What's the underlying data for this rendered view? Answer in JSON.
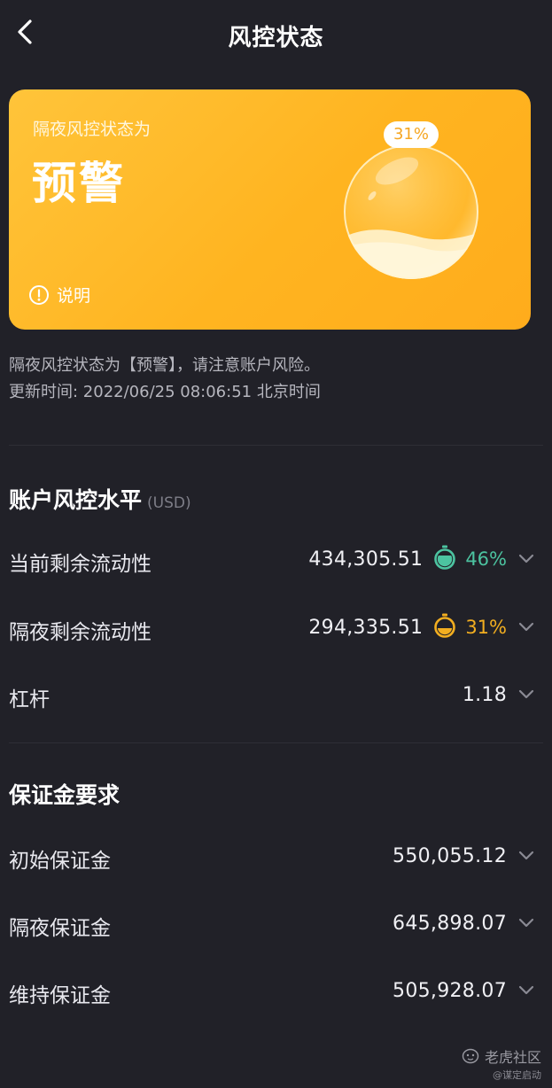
{
  "header": {
    "title": "风控状态",
    "back_icon": "chevron-left-icon"
  },
  "status_card": {
    "subtitle": "隔夜风控状态为",
    "status": "预警",
    "explain_label": "说明",
    "explain_icon": "info-circle-icon",
    "gauge_percent_label": "31%",
    "gauge_fill": 0.31,
    "colors": {
      "card": "#ffb828",
      "badge_text": "#f5a622"
    }
  },
  "notice": {
    "line1": "隔夜风控状态为【预警】，请注意账户风险。",
    "line2": "更新时间: 2022/06/25 08:06:51 北京时间"
  },
  "risk_section": {
    "title": "账户风控水平",
    "unit": "(USD)",
    "rows": [
      {
        "label": "当前剩余流动性",
        "value": "434,305.51",
        "percent": "46%",
        "level": 0.46,
        "color": "#4cc3a0"
      },
      {
        "label": "隔夜剩余流动性",
        "value": "294,335.51",
        "percent": "31%",
        "level": 0.31,
        "color": "#f2ae20"
      },
      {
        "label": "杠杆",
        "value": "1.18"
      }
    ]
  },
  "margin_section": {
    "title": "保证金要求",
    "rows": [
      {
        "label": "初始保证金",
        "value": "550,055.12"
      },
      {
        "label": "隔夜保证金",
        "value": "645,898.07"
      },
      {
        "label": "维持保证金",
        "value": "505,928.07"
      }
    ]
  },
  "watermark": {
    "brand": "老虎社区",
    "handle": "@谋定启动"
  }
}
